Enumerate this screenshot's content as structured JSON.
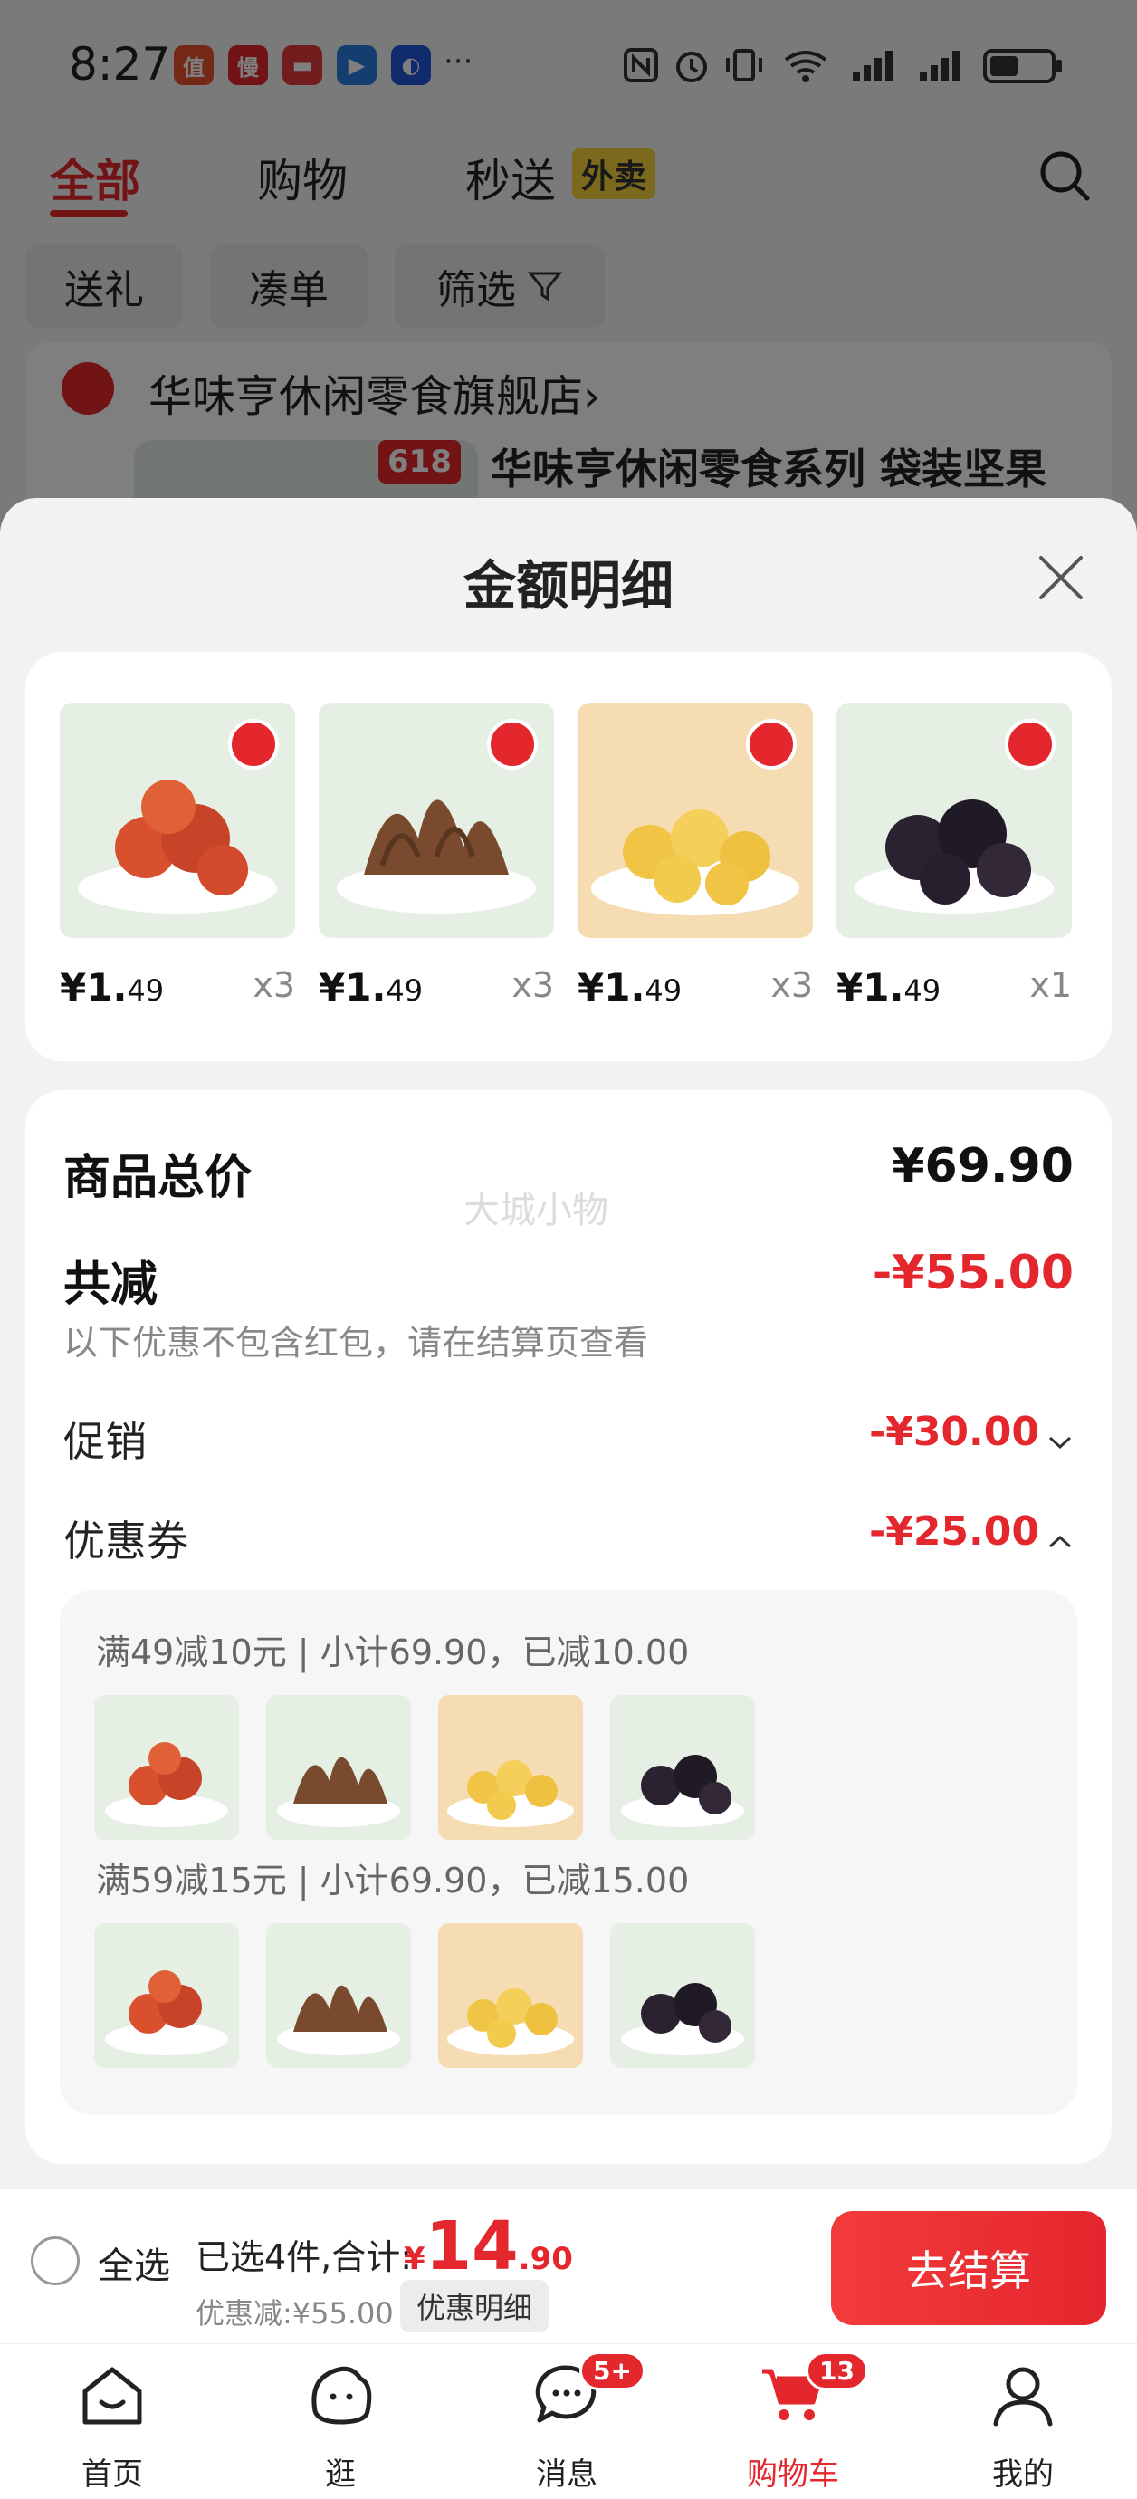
{
  "status_bar": {
    "time": "8:27",
    "app_icons": [
      {
        "name": "app-icon-1",
        "glyph": "值",
        "color": "#e9502d"
      },
      {
        "name": "app-icon-2",
        "glyph": "慢",
        "color": "#e4262d"
      },
      {
        "name": "app-icon-3",
        "glyph": "▬",
        "color": "#e3393b"
      },
      {
        "name": "app-icon-4",
        "glyph": "▶",
        "color": "#2a7de1"
      },
      {
        "name": "app-icon-5",
        "glyph": "◐",
        "color": "#2157d6"
      }
    ],
    "more": "···"
  },
  "top_nav": {
    "tabs": [
      "全部",
      "购物",
      "秒送"
    ],
    "badge": "外卖"
  },
  "filters": [
    "送礼",
    "凑单",
    "筛选"
  ],
  "store": {
    "name": "华味亨休闲零食旗舰店",
    "chevron": "›",
    "tag": "618",
    "product_title": "华味亨休闲零食系列 袋装坚果"
  },
  "sheet": {
    "title": "金额明细",
    "products": [
      {
        "price_int": "¥1.",
        "price_dec": "49",
        "qty": "x3",
        "color": "#d9502f",
        "bg": "#e6efe4"
      },
      {
        "price_int": "¥1.",
        "price_dec": "49",
        "qty": "x3",
        "color": "#7a4a2e",
        "bg": "#e6efe4"
      },
      {
        "price_int": "¥1.",
        "price_dec": "49",
        "qty": "x3",
        "color": "#f0c445",
        "bg": "#f6dcb2"
      },
      {
        "price_int": "¥1.",
        "price_dec": "49",
        "qty": "x1",
        "color": "#2a2230",
        "bg": "#e6efe4"
      }
    ],
    "summary": {
      "watermark": "大城小物",
      "total_label": "商品总价",
      "total_value": "¥69.90",
      "reduce_label": "共减",
      "reduce_value": "-¥55.00",
      "reduce_note": "以下优惠不包含红包，请在结算页查看",
      "promo_label": "促销",
      "promo_value": "-¥30.00",
      "coupon_label": "优惠券",
      "coupon_value": "-¥25.00",
      "coupon_groups": [
        {
          "title": "满49减10元 | 小计69.90，已减10.00"
        },
        {
          "title": "满59减15元 | 小计69.90，已减15.00"
        }
      ]
    }
  },
  "bottom_bar": {
    "select_all": "全选",
    "selected": "已选4件,合计:",
    "currency": "¥",
    "total_int": "14",
    "total_dec": ".90",
    "discount": "优惠减:¥55.00",
    "detail_button": "优惠明细",
    "checkout": "去结算"
  },
  "tab_bar": {
    "items": [
      {
        "label": "首页"
      },
      {
        "label": "逛"
      },
      {
        "label": "消息",
        "badge": "5+"
      },
      {
        "label": "购物车",
        "badge": "13"
      },
      {
        "label": "我的"
      }
    ],
    "accent": "#e4262d"
  }
}
